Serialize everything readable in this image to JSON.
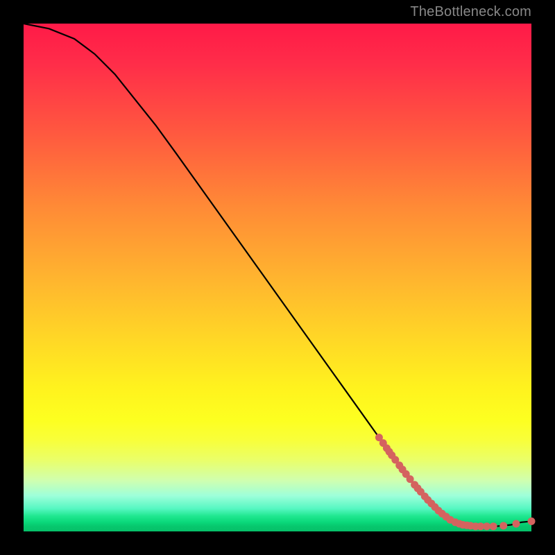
{
  "attribution": "TheBottleneck.com",
  "chart_data": {
    "type": "line",
    "title": "",
    "xlabel": "",
    "ylabel": "",
    "xlim": [
      0,
      100
    ],
    "ylim": [
      0,
      100
    ],
    "curve": [
      {
        "x": 0,
        "y": 100
      },
      {
        "x": 5,
        "y": 99
      },
      {
        "x": 10,
        "y": 97
      },
      {
        "x": 14,
        "y": 94
      },
      {
        "x": 18,
        "y": 90
      },
      {
        "x": 22,
        "y": 85
      },
      {
        "x": 26,
        "y": 80
      },
      {
        "x": 30,
        "y": 74.5
      },
      {
        "x": 35,
        "y": 67.5
      },
      {
        "x": 40,
        "y": 60.5
      },
      {
        "x": 45,
        "y": 53.5
      },
      {
        "x": 50,
        "y": 46.5
      },
      {
        "x": 55,
        "y": 39.5
      },
      {
        "x": 60,
        "y": 32.5
      },
      {
        "x": 65,
        "y": 25.5
      },
      {
        "x": 70,
        "y": 18.5
      },
      {
        "x": 74,
        "y": 13
      },
      {
        "x": 78,
        "y": 8
      },
      {
        "x": 82,
        "y": 4
      },
      {
        "x": 85,
        "y": 1.8
      },
      {
        "x": 87,
        "y": 1.2
      },
      {
        "x": 90,
        "y": 1.0
      },
      {
        "x": 93,
        "y": 1.0
      },
      {
        "x": 96,
        "y": 1.3
      },
      {
        "x": 98,
        "y": 1.8
      },
      {
        "x": 100,
        "y": 2
      }
    ],
    "series": [
      {
        "name": "scatter-points",
        "points": [
          {
            "x": 70.0,
            "y": 18.5
          },
          {
            "x": 70.8,
            "y": 17.4
          },
          {
            "x": 71.5,
            "y": 16.4
          },
          {
            "x": 72.0,
            "y": 15.7
          },
          {
            "x": 72.5,
            "y": 15.0
          },
          {
            "x": 73.2,
            "y": 14.1
          },
          {
            "x": 74.0,
            "y": 13.0
          },
          {
            "x": 74.6,
            "y": 12.2
          },
          {
            "x": 75.3,
            "y": 11.3
          },
          {
            "x": 76.1,
            "y": 10.3
          },
          {
            "x": 77.0,
            "y": 9.2
          },
          {
            "x": 77.6,
            "y": 8.5
          },
          {
            "x": 78.2,
            "y": 7.8
          },
          {
            "x": 79.0,
            "y": 6.9
          },
          {
            "x": 79.6,
            "y": 6.2
          },
          {
            "x": 80.3,
            "y": 5.5
          },
          {
            "x": 81.0,
            "y": 4.8
          },
          {
            "x": 81.7,
            "y": 4.1
          },
          {
            "x": 82.4,
            "y": 3.5
          },
          {
            "x": 83.2,
            "y": 2.9
          },
          {
            "x": 84.0,
            "y": 2.3
          },
          {
            "x": 85.0,
            "y": 1.8
          },
          {
            "x": 85.8,
            "y": 1.5
          },
          {
            "x": 86.5,
            "y": 1.3
          },
          {
            "x": 87.3,
            "y": 1.2
          },
          {
            "x": 88.0,
            "y": 1.1
          },
          {
            "x": 89.0,
            "y": 1.0
          },
          {
            "x": 90.0,
            "y": 1.0
          },
          {
            "x": 91.2,
            "y": 1.0
          },
          {
            "x": 92.5,
            "y": 1.0
          },
          {
            "x": 94.5,
            "y": 1.1
          },
          {
            "x": 97.0,
            "y": 1.5
          },
          {
            "x": 100.0,
            "y": 2.0
          }
        ]
      }
    ]
  }
}
